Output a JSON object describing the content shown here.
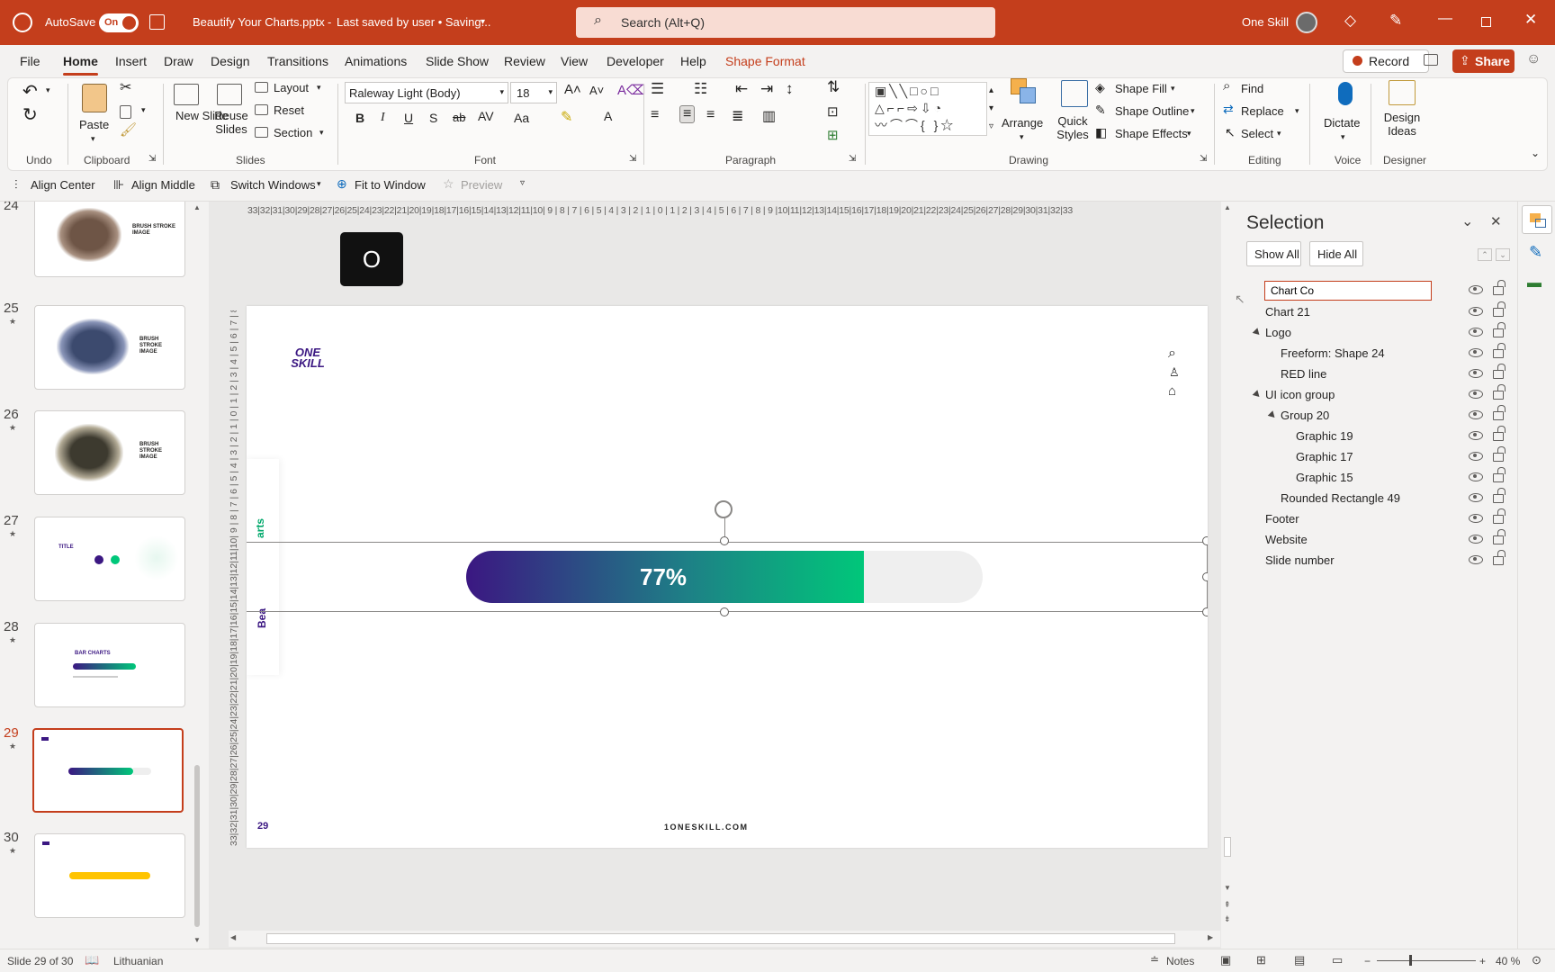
{
  "titlebar": {
    "autosave_label": "AutoSave",
    "autosave_state": "On",
    "filename": "Beautify Your Charts.pptx",
    "save_status": "Last saved by user • Saving...",
    "search_placeholder": "Search (Alt+Q)",
    "user_name": "One Skill"
  },
  "tabs": [
    "File",
    "Home",
    "Insert",
    "Draw",
    "Design",
    "Transitions",
    "Animations",
    "Slide Show",
    "Review",
    "View",
    "Developer",
    "Help",
    "Shape Format"
  ],
  "tabs_right": {
    "record": "Record",
    "share": "Share"
  },
  "ribbon": {
    "undo_group": "Undo",
    "clipboard": {
      "label": "Clipboard",
      "paste": "Paste"
    },
    "slides": {
      "label": "Slides",
      "new_slide": "New Slide",
      "reuse": "Reuse Slides",
      "layout": "Layout",
      "reset": "Reset",
      "section": "Section"
    },
    "font": {
      "label": "Font",
      "family": "Raleway Light (Body)",
      "size": "18"
    },
    "paragraph": {
      "label": "Paragraph"
    },
    "drawing": {
      "label": "Drawing",
      "arrange": "Arrange",
      "quick_styles": "Quick Styles",
      "fill": "Shape Fill",
      "outline": "Shape Outline",
      "effects": "Shape Effects"
    },
    "editing": {
      "label": "Editing",
      "find": "Find",
      "replace": "Replace",
      "select": "Select"
    },
    "voice": {
      "label": "Voice",
      "dictate": "Dictate"
    },
    "designer": {
      "label": "Designer",
      "ideas": "Design Ideas"
    }
  },
  "qat": {
    "align_center": "Align Center",
    "align_middle": "Align Middle",
    "switch_windows": "Switch Windows",
    "fit": "Fit to Window",
    "preview": "Preview"
  },
  "thumbs": [
    {
      "num": "24",
      "title": "BRUSH STROKE IMAGE"
    },
    {
      "num": "25",
      "title": "BRUSH STROKE IMAGE"
    },
    {
      "num": "26",
      "title": "BRUSH STROKE IMAGE"
    },
    {
      "num": "27",
      "title": "TITLE"
    },
    {
      "num": "28",
      "title": "BAR CHARTS"
    },
    {
      "num": "29",
      "title": ""
    },
    {
      "num": "30",
      "title": ""
    }
  ],
  "ruler_h": "33|32|31|30|29|28|27|26|25|24|23|22|21|20|19|18|17|16|15|14|13|12|11|10| 9 | 8 | 7 | 6 | 5 | 4 | 3 | 2 | 1 | 0 | 1 | 2 | 3 | 4 | 5 | 6 | 7 | 8 | 9 |10|11|12|13|14|15|16|17|18|19|20|21|22|23|24|25|26|27|28|29|30|31|32|33",
  "key_overlay": "O",
  "slide": {
    "logo_line1": "ONE",
    "logo_line2": "SKILL",
    "vertical_text_top": "arts",
    "vertical_text_bottom": "Bea",
    "bar_label": "77%",
    "bar_value": 0.77,
    "slide_number": "29",
    "website": "1ONESKILL.COM"
  },
  "selection_pane": {
    "title": "Selection",
    "show_all": "Show All",
    "hide_all": "Hide All",
    "editing_value": "Chart Co",
    "items": [
      {
        "label": "Chart 21",
        "indent": 0
      },
      {
        "label": "Logo",
        "indent": 0,
        "group": true
      },
      {
        "label": "Freeform: Shape 24",
        "indent": 1
      },
      {
        "label": "RED line",
        "indent": 1
      },
      {
        "label": "UI icon group",
        "indent": 0,
        "group": true
      },
      {
        "label": "Group 20",
        "indent": 1,
        "group": true
      },
      {
        "label": "Graphic 19",
        "indent": 2
      },
      {
        "label": "Graphic 17",
        "indent": 2
      },
      {
        "label": "Graphic 15",
        "indent": 2
      },
      {
        "label": "Rounded Rectangle 49",
        "indent": 1
      },
      {
        "label": "Footer",
        "indent": 0
      },
      {
        "label": "Website",
        "indent": 0
      },
      {
        "label": "Slide number",
        "indent": 0
      }
    ]
  },
  "status": {
    "slide": "Slide 29 of 30",
    "language": "Lithuanian",
    "notes": "Notes",
    "zoom": "40 %"
  },
  "colors": {
    "accent": "#c43e1c",
    "bar_start": "#3b1782",
    "bar_end": "#00c77a"
  }
}
